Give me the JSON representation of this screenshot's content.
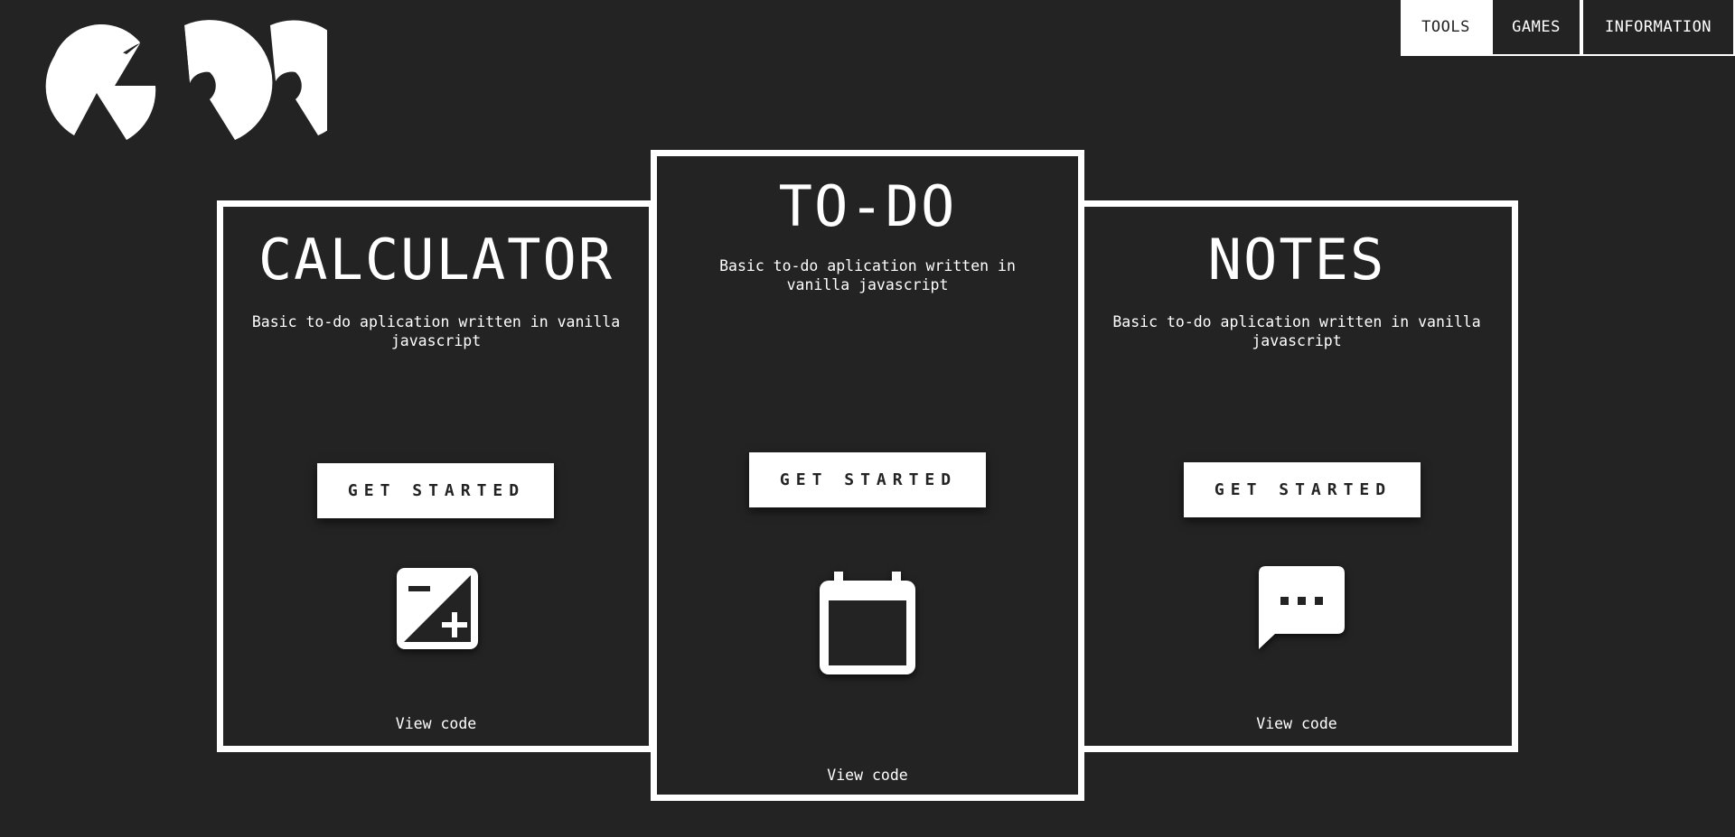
{
  "logo": {
    "icon": "grr-logo-icon"
  },
  "nav": {
    "items": [
      {
        "label": "TOOLS",
        "active": true
      },
      {
        "label": "GAMES",
        "active": false
      },
      {
        "label": "INFORMATION",
        "active": false
      }
    ]
  },
  "cards": [
    {
      "title": "CALCULATOR",
      "description": "Basic to-do aplication written in vanilla javascript",
      "button_label": "GET STARTED",
      "icon": "exposure-plus-minus-icon",
      "link_label": "View code"
    },
    {
      "title": "TO-DO",
      "description": "Basic to-do aplication written in vanilla javascript",
      "button_label": "GET STARTED",
      "icon": "calendar-icon",
      "link_label": "View code"
    },
    {
      "title": "NOTES",
      "description": "Basic to-do aplication written in vanilla javascript",
      "button_label": "GET STARTED",
      "icon": "chat-bubble-dots-icon",
      "link_label": "View code"
    }
  ],
  "colors": {
    "background": "#232323",
    "foreground": "#ffffff"
  }
}
